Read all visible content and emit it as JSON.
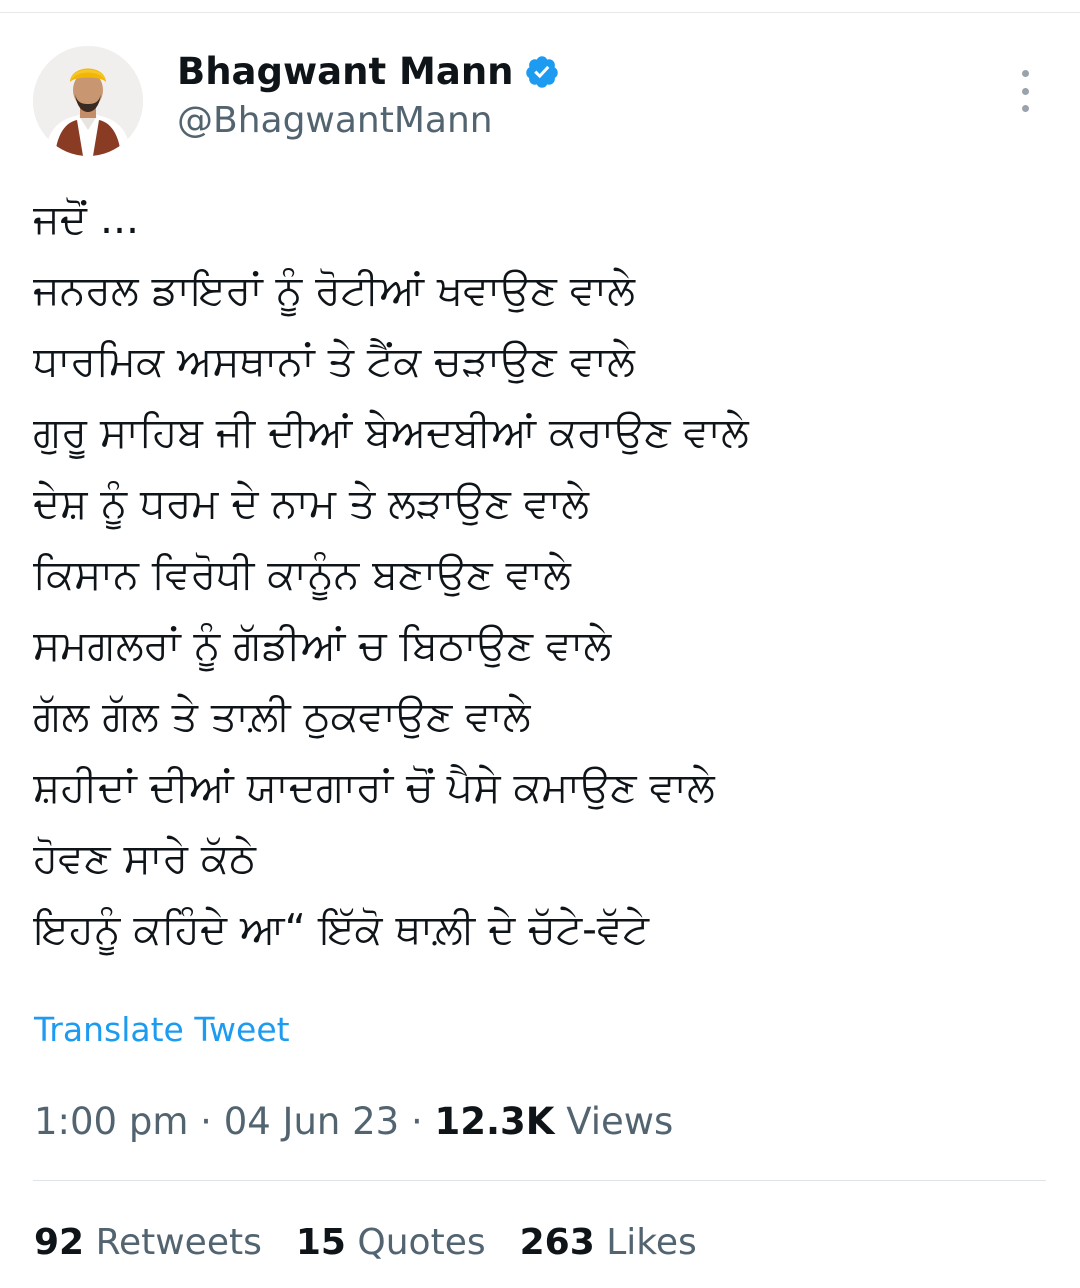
{
  "author": {
    "display_name": "Bhagwant Mann",
    "handle": "@BhagwantMann"
  },
  "tweet": {
    "lines": [
      "ਜਦੋਂ ...",
      "ਜਨਰਲ ਡਾਇਰਾਂ ਨੂੰ ਰੋਟੀਆਂ ਖਵਾਉਣ ਵਾਲੇ",
      "ਧਾਰਮਿਕ ਅਸਥਾਨਾਂ ਤੇ ਟੈਂਕ ਚੜਾਉਣ ਵਾਲੇ",
      "ਗੁਰੂ ਸਾਹਿਬ ਜੀ ਦੀਆਂ ਬੇਅਦਬੀਆਂ ਕਰਾਉਣ ਵਾਲੇ",
      "ਦੇਸ਼ ਨੂੰ ਧਰਮ ਦੇ ਨਾਮ ਤੇ ਲੜਾਉਣ ਵਾਲੇ",
      "ਕਿਸਾਨ ਵਿਰੋਧੀ ਕਾਨੂੰਨ ਬਣਾਉਣ ਵਾਲੇ",
      "ਸਮਗਲਰਾਂ ਨੂੰ ਗੱਡੀਆਂ ਚ ਬਿਠਾਉਣ ਵਾਲੇ",
      "ਗੱਲ ਗੱਲ ਤੇ ਤਾਲ਼ੀ ਠੁਕਵਾਉਣ ਵਾਲੇ",
      "ਸ਼ਹੀਦਾਂ ਦੀਆਂ ਯਾਦਗਾਰਾਂ  ਚੋਂ ਪੈਸੇ ਕਮਾਉਣ ਵਾਲੇ",
      "ਹੋਵਣ ਸਾਰੇ ਕੱਠੇ",
      "ਇਹਨੂੰ ਕਹਿੰਦੇ ਆ“ ਇੱਕੋ ਥਾਲ਼ੀ ਦੇ ਚੱਟੇ-ਵੱਟੇ"
    ],
    "translate_label": "Translate Tweet",
    "time": "1:00 pm",
    "date": "04 Jun 23",
    "separator": "·",
    "views_count": "12.3K",
    "views_label": "Views"
  },
  "stats": {
    "retweets": {
      "count": "92",
      "label": "Retweets"
    },
    "quotes": {
      "count": "15",
      "label": "Quotes"
    },
    "likes": {
      "count": "263",
      "label": "Likes"
    }
  },
  "colors": {
    "verified_badge": "#1d9bf0",
    "link": "#1d9bf0",
    "secondary_text": "#536471",
    "avatar_turban": "#f2b705"
  },
  "icons": {
    "verified": "verified-badge-icon",
    "more": "more-options-icon"
  }
}
